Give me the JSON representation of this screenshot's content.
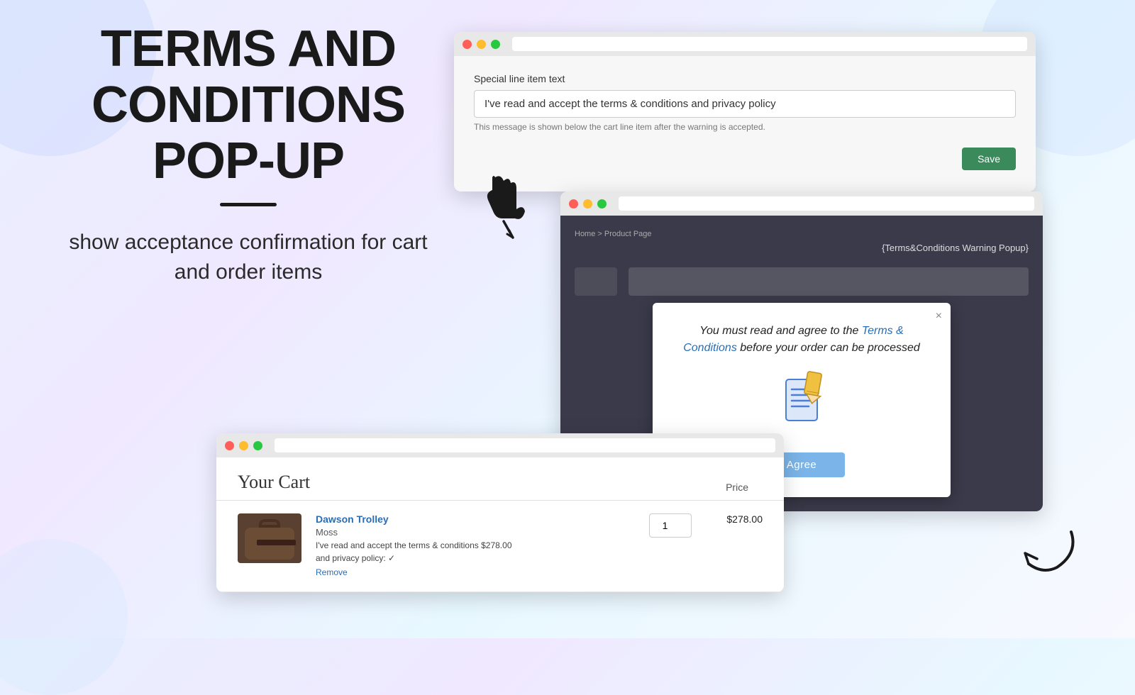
{
  "headline": {
    "line1": "TERMS AND",
    "line2": "CONDITIONS",
    "line3": "POP-UP"
  },
  "subtext": "show acceptance confirmation for cart\nand order items",
  "settings_panel": {
    "field_label": "Special line item text",
    "field_value": "I've read and accept the terms & conditions and privacy policy",
    "field_hint": "This message is shown below the cart line item after the warning is accepted.",
    "save_label": "Save"
  },
  "popup_modal": {
    "section_title": "{Terms&Conditions Warning Popup}",
    "breadcrumb": "Home > Product Page",
    "message_part1": "You must read and agree to the ",
    "message_link": "Terms & Conditions",
    "message_part2": " before your order can be processed",
    "agree_label": "Agree",
    "close_label": "×"
  },
  "cart": {
    "title": "Your Cart",
    "price_col": "Price",
    "item": {
      "name": "Dawson Trolley",
      "variant": "Moss",
      "terms_text": "I've read and accept the terms & conditions",
      "terms_price": "$278.00",
      "privacy_text": "and privacy policy: ✓",
      "price": "$278.00",
      "quantity": "1",
      "total": "$278.00",
      "remove_label": "Remove"
    }
  },
  "icons": {
    "close": "×",
    "check": "✓"
  }
}
